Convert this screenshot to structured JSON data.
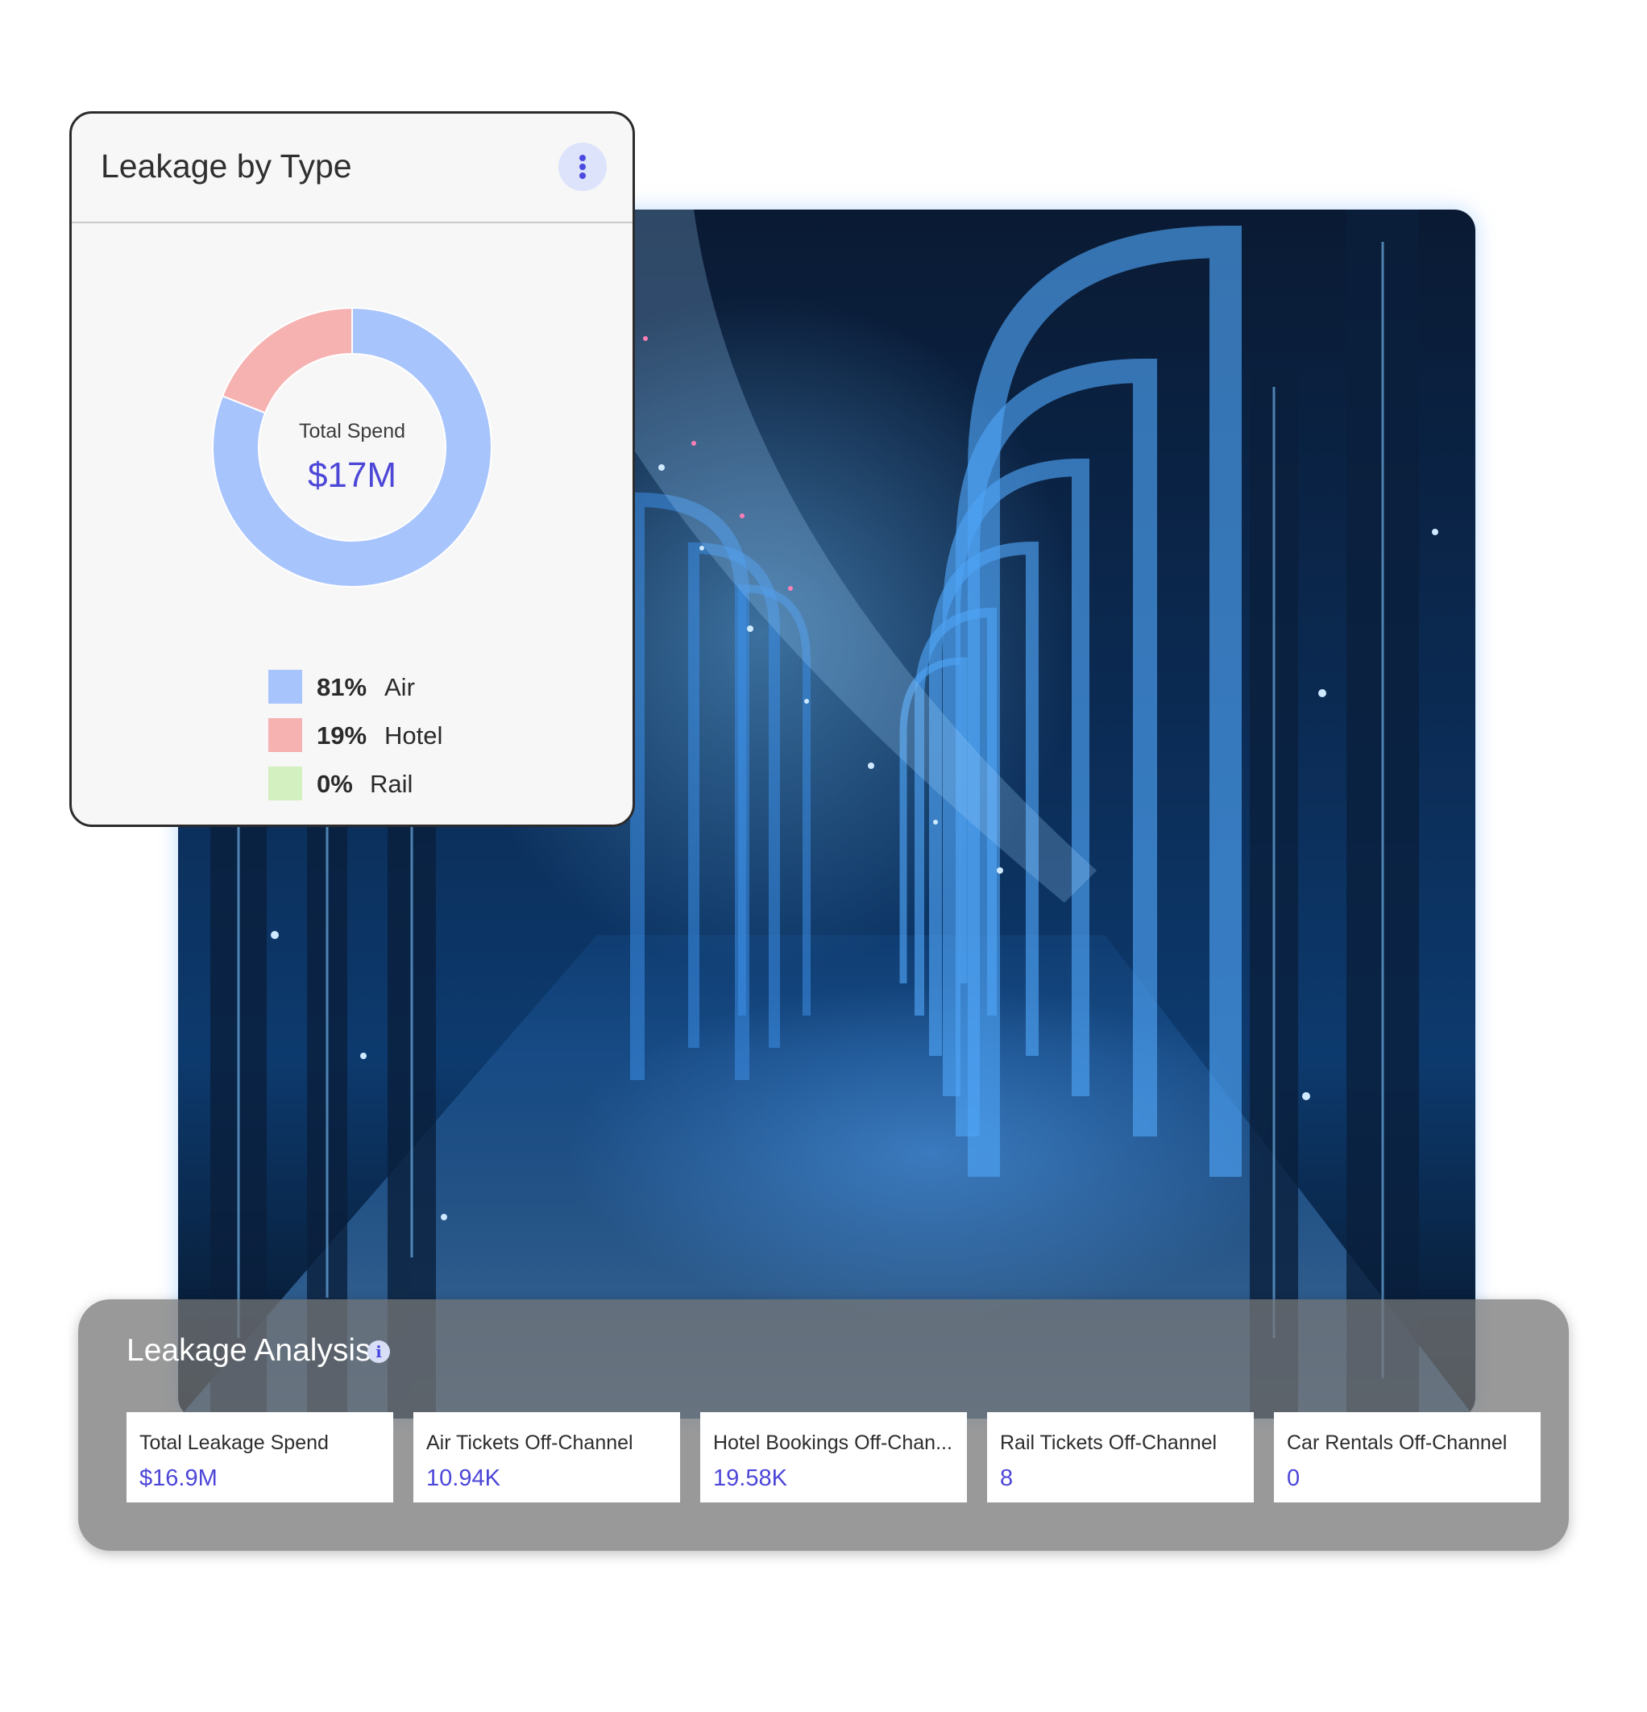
{
  "leakage_by_type": {
    "title": "Leakage by Type",
    "center_caption": "Total Spend",
    "center_value": "$17M",
    "legend": [
      {
        "pct": "81%",
        "name": "Air",
        "color": "#a8c4fc"
      },
      {
        "pct": "19%",
        "name": "Hotel",
        "color": "#f6b1b1"
      },
      {
        "pct": "0%",
        "name": "Rail",
        "color": "#d3f0c0"
      }
    ],
    "chart_data": {
      "type": "pie",
      "categories": [
        "Air",
        "Hotel",
        "Rail"
      ],
      "values": [
        81,
        19,
        0
      ],
      "title": "Leakage by Type"
    }
  },
  "leakage_analysis": {
    "title": "Leakage Analysis",
    "info_icon": "info-icon",
    "metrics": [
      {
        "label": "Total Leakage Spend",
        "value": "$16.9M"
      },
      {
        "label": "Air Tickets Off-Channel",
        "value": "10.94K"
      },
      {
        "label": "Hotel Bookings Off-Chan...",
        "value": "19.58K"
      },
      {
        "label": "Rail Tickets Off-Channel",
        "value": "8"
      },
      {
        "label": "Car Rentals Off-Channel",
        "value": "0"
      }
    ]
  },
  "colors": {
    "accent": "#4d47d8",
    "kebab_bg": "#dde3fb"
  }
}
